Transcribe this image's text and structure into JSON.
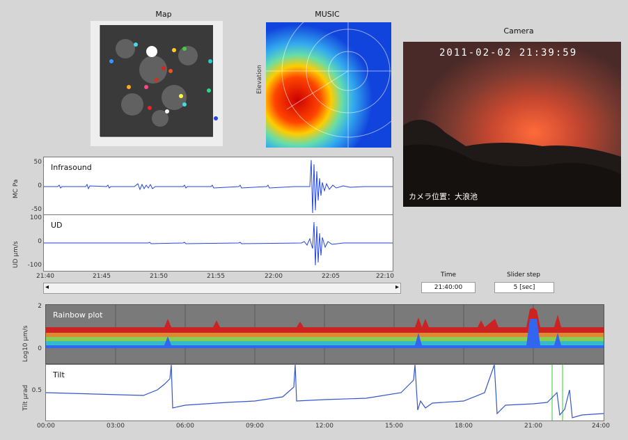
{
  "panels": {
    "map_title": "Map",
    "music_title": "MUSIC",
    "music_ylabel": "Elevation",
    "camera_title": "Camera",
    "camera_timestamp": "2011-02-02 21:39:59",
    "camera_caption": "カメラ位置：大浪池"
  },
  "infrasound": {
    "label": "Infrasound",
    "ylabel": "MC Pa",
    "yticks": [
      "50",
      "0",
      "-50"
    ]
  },
  "ud": {
    "label": "UD",
    "ylabel": "UD μm/s",
    "yticks": [
      "100",
      "0",
      "-100"
    ]
  },
  "waveform_xticks": [
    "21:40",
    "21:45",
    "21:50",
    "21:55",
    "22:00",
    "22:05",
    "22:10"
  ],
  "controls": {
    "time_label": "Time",
    "time_value": "21:40:00",
    "slider_step_label": "Slider step",
    "slider_step_value": "5 [sec]",
    "scroll_left": "◂",
    "scroll_right": "▸"
  },
  "rainbow": {
    "label": "Rainbow plot",
    "ylabel": "Log10 μm/s",
    "yticks": [
      "2",
      "0"
    ]
  },
  "tilt": {
    "label": "Tilt",
    "ylabel": "Tilt μrad",
    "yticks": [
      "0.5"
    ]
  },
  "bottom_xticks": [
    "00:00",
    "03:00",
    "06:00",
    "09:00",
    "12:00",
    "15:00",
    "18:00",
    "21:00",
    "24:00"
  ],
  "colors": {
    "waveform": "#2244dd",
    "rainbow_bg": "#7a7a7a",
    "tilt": "#3355cc",
    "marker": "#33cc33"
  }
}
